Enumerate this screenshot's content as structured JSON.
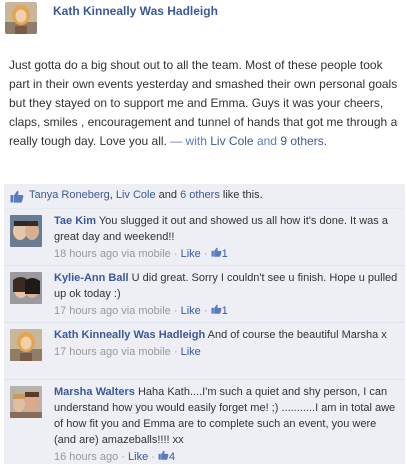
{
  "post": {
    "author": "Kath Kinneally Was Hadleigh",
    "text": "Just gotta do a big shout out to all the team. Most of these people took part in their own events yesterday and smashed their own personal goals but they stayed on to support me and Emma. Guys it was your cheers, claps, smiles , encouragement and tunnel of hands that got me through a really tough day. Love you all.",
    "with_prefix": "— with",
    "with_person": "Liv Cole",
    "with_and": "and",
    "with_others": "9 others."
  },
  "likes": {
    "person1": "Tanya Roneberg",
    "sep": ",",
    "person2": "Liv Cole",
    "and": "and",
    "others": "6 others",
    "suffix": "like this."
  },
  "comments": [
    {
      "name": "Tae Kim",
      "text": "You slugged it out and showed us all how it's done. It was a great day and weekend!!",
      "time": "18 hours ago via mobile",
      "sep1": "·",
      "like_label": "Like",
      "sep2": "·",
      "like_count": "1"
    },
    {
      "name": "Kylie-Ann Ball",
      "text": "U did great. Sorry I couldn't see u finish. Hope u pulled up ok today :)",
      "time": "17 hours ago via mobile",
      "sep1": "·",
      "like_label": "Like",
      "sep2": "·",
      "like_count": "1"
    },
    {
      "name": "Kath Kinneally Was Hadleigh",
      "text": "And of course the beautiful Marsha x",
      "time": "17 hours ago via mobile",
      "sep1": "·",
      "like_label": "Like",
      "sep2": "",
      "like_count": ""
    },
    {
      "name": "Marsha Walters",
      "text": "Haha Kath....I'm such a quiet and shy person, I can understand how you would easily forget me! ;) ...........I am in total awe of how fit you and Emma are to complete such an event, you were (and are) amazeballs!!!! xx",
      "time": "16 hours ago",
      "sep1": "·",
      "like_label": "Like",
      "sep2": "·",
      "like_count": "4"
    }
  ],
  "colors": {
    "link": "#3b5998",
    "comment_bg": "#edeff4",
    "meta": "#999999"
  },
  "icons": {
    "like": "thumbs-up-icon"
  }
}
